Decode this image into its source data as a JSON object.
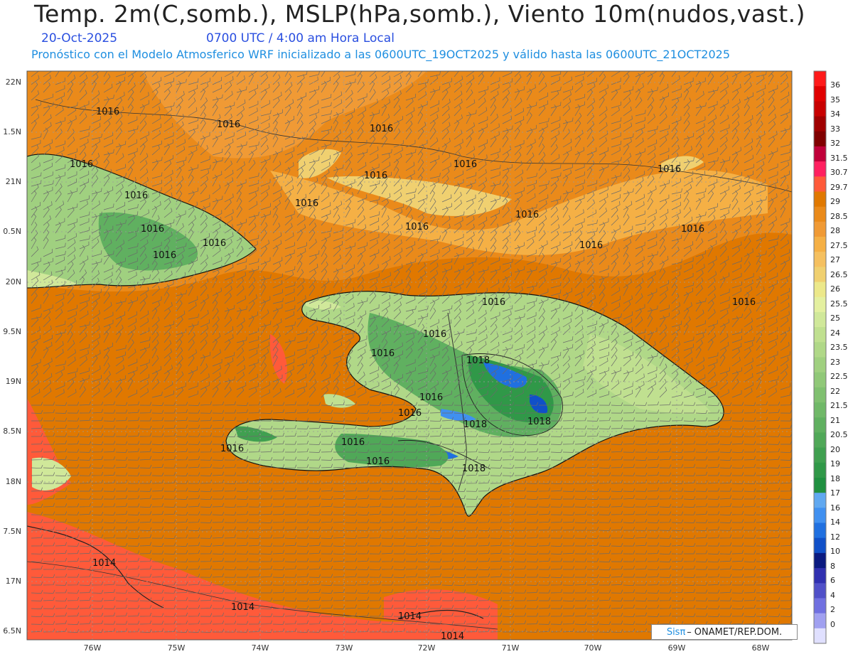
{
  "header": {
    "title": "Temp. 2m(C,somb.), MSLP(hPa,somb.), Viento 10m(nudos,vast.)",
    "date": "20-Oct-2025",
    "time": "0700 UTC / 4:00 am Hora Local",
    "subtitle": "Pronóstico con el Modelo Atmosferico WRF inicializado a las 0600UTC_19OCT2025 y válido hasta las  0600UTC_21OCT2025"
  },
  "axes": {
    "lat_labels": [
      "22N",
      "1.5N",
      "21N",
      "0.5N",
      "20N",
      "9.5N",
      "19N",
      "8.5N",
      "18N",
      "7.5N",
      "17N",
      "6.5N"
    ],
    "lon_labels": [
      "76W",
      "75W",
      "74W",
      "73W",
      "72W",
      "71W",
      "70W",
      "69W",
      "68W"
    ]
  },
  "colorbar": {
    "labels": [
      "36",
      "35",
      "34",
      "33",
      "32",
      "31.5",
      "30.7",
      "29.7",
      "29",
      "28.5",
      "28",
      "27.5",
      "27",
      "26.5",
      "26",
      "25.5",
      "25",
      "24",
      "23.5",
      "23",
      "22.5",
      "22",
      "21.5",
      "21",
      "20.5",
      "20",
      "19",
      "18",
      "17",
      "16",
      "14",
      "12",
      "10",
      "8",
      "6",
      "4",
      "2",
      "0"
    ],
    "colors": [
      "#ff1a1a",
      "#e00000",
      "#c80000",
      "#a00000",
      "#800000",
      "#c0003a",
      "#ff2060",
      "#ff5a3a",
      "#e07800",
      "#ea8a1a",
      "#f09a35",
      "#f5b045",
      "#f5c060",
      "#f0d070",
      "#ece88a",
      "#e4f0a0",
      "#d0e89a",
      "#c0e090",
      "#b0d888",
      "#a0d080",
      "#90c878",
      "#80c070",
      "#70b868",
      "#60b060",
      "#50a858",
      "#40a050",
      "#309848",
      "#209040",
      "#60a8f0",
      "#4090f0",
      "#2070e0",
      "#1050c8",
      "#0a1a80",
      "#3030b0",
      "#5050c8",
      "#7070e0",
      "#a0a0f0",
      "#e0e0ff"
    ]
  },
  "isobar_labels": [
    {
      "text": "1016"
    },
    {
      "text": "1016"
    },
    {
      "text": "1016"
    },
    {
      "text": "1016"
    },
    {
      "text": "1016"
    },
    {
      "text": "1016"
    },
    {
      "text": "1016"
    },
    {
      "text": "1016"
    },
    {
      "text": "1016"
    },
    {
      "text": "1016"
    },
    {
      "text": "1016"
    },
    {
      "text": "1016"
    },
    {
      "text": "1016"
    },
    {
      "text": "1016"
    },
    {
      "text": "1016"
    },
    {
      "text": "1016"
    },
    {
      "text": "1016"
    },
    {
      "text": "1016"
    },
    {
      "text": "1016"
    },
    {
      "text": "1016"
    },
    {
      "text": "1016"
    },
    {
      "text": "1016"
    },
    {
      "text": "1016"
    },
    {
      "text": "1016"
    },
    {
      "text": "1016"
    },
    {
      "text": "1018"
    },
    {
      "text": "1018"
    },
    {
      "text": "1018"
    },
    {
      "text": "1018"
    },
    {
      "text": "1014"
    },
    {
      "text": "1014"
    },
    {
      "text": "1014"
    },
    {
      "text": "1014"
    }
  ],
  "credit": {
    "sis": "Sisπ",
    "dash": "–",
    "org": "ONAMET/REP.DOM."
  }
}
